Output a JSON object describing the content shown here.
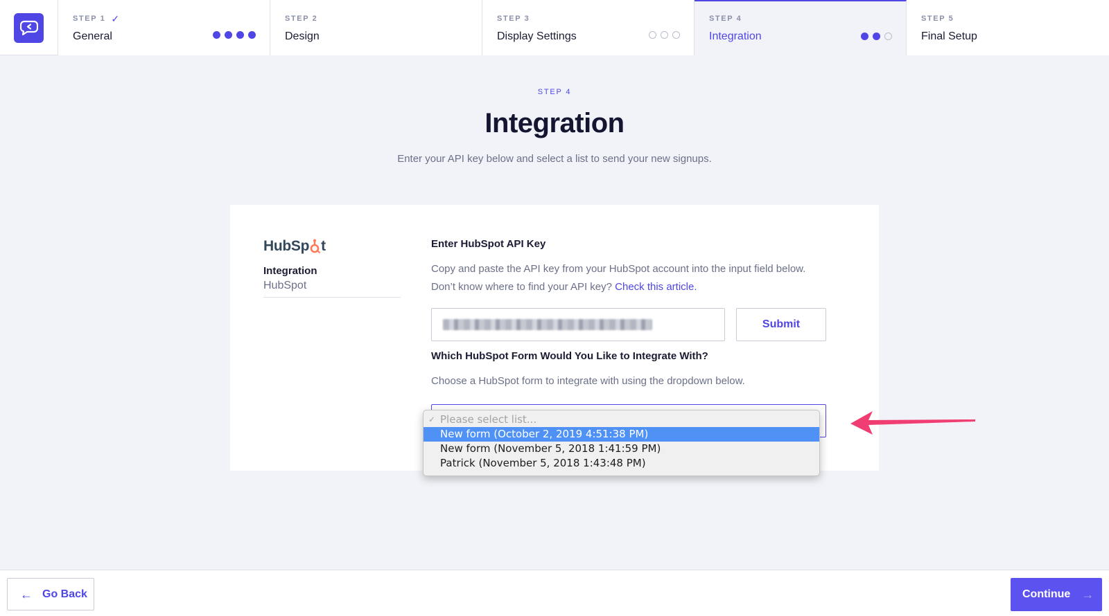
{
  "steps": [
    {
      "label": "STEP 1",
      "check": "✓",
      "name": "General",
      "dots": [
        "on",
        "on",
        "on",
        "on"
      ]
    },
    {
      "label": "STEP 2",
      "name": "Design"
    },
    {
      "label": "STEP 3",
      "name": "Display Settings",
      "dots": [
        "off",
        "off",
        "off"
      ]
    },
    {
      "label": "STEP 4",
      "name": "Integration",
      "dots": [
        "on",
        "on",
        "off"
      ]
    },
    {
      "label": "STEP 5",
      "name": "Final Setup"
    }
  ],
  "header": {
    "step": "STEP 4",
    "title": "Integration",
    "subtitle": "Enter your API key below and select a list to send your new signups."
  },
  "sidebar": {
    "logo_text_a": "HubSp",
    "logo_text_b": "t",
    "title": "Integration",
    "subtitle": "HubSpot"
  },
  "api": {
    "title": "Enter HubSpot API Key",
    "text": "Copy and paste the API key from your HubSpot account into the input field below. Don’t know where to find your API key? ",
    "link": "Check this article.",
    "submit_label": "Submit"
  },
  "form": {
    "title": "Which HubSpot Form Would You Like to Integrate With?",
    "text": "Choose a HubSpot form to integrate with using the dropdown below."
  },
  "dropdown": {
    "placeholder": "Please select list...",
    "options": [
      "New form (October 2, 2019 4:51:38 PM)",
      "New form (November 5, 2018 1:41:59 PM)",
      "Patrick (November 5, 2018 1:43:48 PM)"
    ],
    "selected_index": 0
  },
  "footer": {
    "back_label": "Go Back",
    "continue_label": "Continue"
  },
  "colors": {
    "accent": "#4f46e5",
    "highlight": "#4f91f5",
    "arrow": "#f03e72",
    "hubspot_orange": "#ff7a59"
  },
  "icons": {
    "app_logo": "chat-back-icon",
    "back": "arrow-left-icon",
    "continue": "arrow-right-icon",
    "annotation": "pointer-arrow-icon"
  }
}
